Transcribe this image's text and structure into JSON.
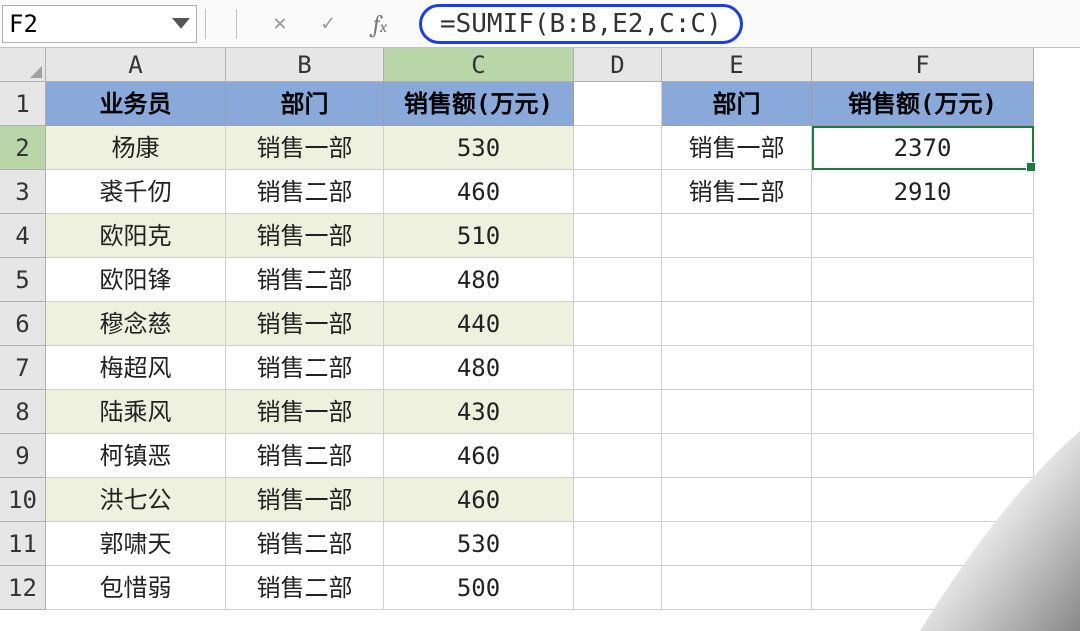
{
  "nameBox": "F2",
  "formula": "=SUMIF(B:B,E2,C:C)",
  "columns": [
    "A",
    "B",
    "C",
    "D",
    "E",
    "F"
  ],
  "rows": [
    "1",
    "2",
    "3",
    "4",
    "5",
    "6",
    "7",
    "8",
    "9",
    "10",
    "11",
    "12"
  ],
  "headers": {
    "A": "业务员",
    "B": "部门",
    "C": "销售额(万元)",
    "E": "部门",
    "F": "销售额(万元)"
  },
  "data": {
    "r2": {
      "A": "杨康",
      "B": "销售一部",
      "C": "530",
      "E": "销售一部",
      "F": "2370"
    },
    "r3": {
      "A": "裘千仞",
      "B": "销售二部",
      "C": "460",
      "E": "销售二部",
      "F": "2910"
    },
    "r4": {
      "A": "欧阳克",
      "B": "销售一部",
      "C": "510"
    },
    "r5": {
      "A": "欧阳锋",
      "B": "销售二部",
      "C": "480"
    },
    "r6": {
      "A": "穆念慈",
      "B": "销售一部",
      "C": "440"
    },
    "r7": {
      "A": "梅超风",
      "B": "销售二部",
      "C": "480"
    },
    "r8": {
      "A": "陆乘风",
      "B": "销售一部",
      "C": "430"
    },
    "r9": {
      "A": "柯镇恶",
      "B": "销售二部",
      "C": "460"
    },
    "r10": {
      "A": "洪七公",
      "B": "销售一部",
      "C": "460"
    },
    "r11": {
      "A": "郭啸天",
      "B": "销售二部",
      "C": "530"
    },
    "r12": {
      "A": "包惜弱",
      "B": "销售二部",
      "C": "500"
    }
  },
  "activeColumn": "C",
  "activeRow": "2"
}
